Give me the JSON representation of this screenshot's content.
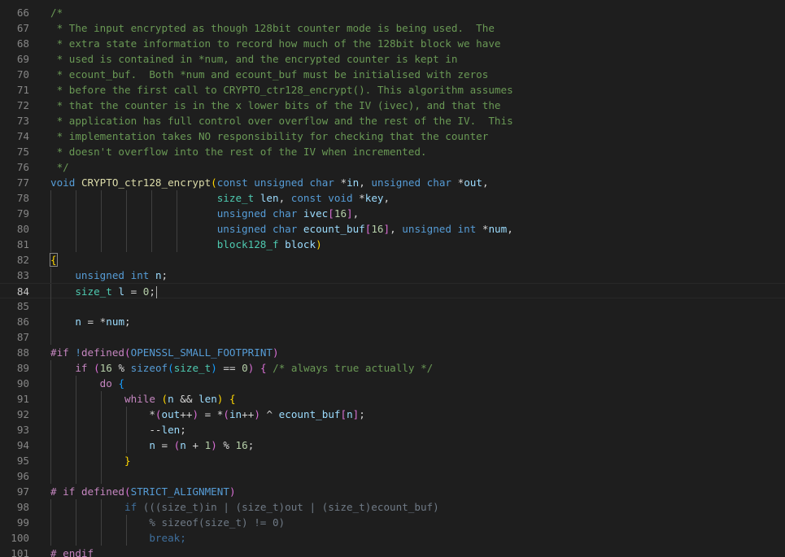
{
  "editor": {
    "current_line": 84,
    "colors": {
      "background": "#1e1e1e",
      "comment": "#6a9955",
      "keyword": "#569cd6",
      "control": "#c586c0",
      "function": "#dcdcaa",
      "type": "#4ec9b0",
      "variable": "#9cdcfe",
      "number": "#b5cea8",
      "plain": "#d4d4d4",
      "bracket_gold": "#ffd700",
      "bracket_purple": "#da70d6",
      "bracket_blue": "#179fff",
      "inactive": "#6f7a86"
    },
    "lines": [
      {
        "n": 66,
        "indent": 0,
        "t": [
          [
            "c",
            "/*"
          ]
        ]
      },
      {
        "n": 67,
        "indent": 0,
        "t": [
          [
            "c",
            " * The input encrypted as though 128bit counter mode is being used.  The"
          ]
        ]
      },
      {
        "n": 68,
        "indent": 0,
        "t": [
          [
            "c",
            " * extra state information to record how much of the 128bit block we have"
          ]
        ]
      },
      {
        "n": 69,
        "indent": 0,
        "t": [
          [
            "c",
            " * used is contained in *num, and the encrypted counter is kept in"
          ]
        ]
      },
      {
        "n": 70,
        "indent": 0,
        "t": [
          [
            "c",
            " * ecount_buf.  Both *num and ecount_buf must be initialised with zeros"
          ]
        ]
      },
      {
        "n": 71,
        "indent": 0,
        "t": [
          [
            "c",
            " * before the first call to CRYPTO_ctr128_encrypt(). This algorithm assumes"
          ]
        ]
      },
      {
        "n": 72,
        "indent": 0,
        "t": [
          [
            "c",
            " * that the counter is in the x lower bits of the IV (ivec), and that the"
          ]
        ]
      },
      {
        "n": 73,
        "indent": 0,
        "t": [
          [
            "c",
            " * application has full control over overflow and the rest of the IV.  This"
          ]
        ]
      },
      {
        "n": 74,
        "indent": 0,
        "t": [
          [
            "c",
            " * implementation takes NO responsibility for checking that the counter"
          ]
        ]
      },
      {
        "n": 75,
        "indent": 0,
        "t": [
          [
            "c",
            " * doesn't overflow into the rest of the IV when incremented."
          ]
        ]
      },
      {
        "n": 76,
        "indent": 0,
        "t": [
          [
            "c",
            " */"
          ]
        ]
      },
      {
        "n": 77,
        "indent": 0,
        "t": [
          [
            "k",
            "void"
          ],
          [
            "p",
            " "
          ],
          [
            "f",
            "CRYPTO_ctr128_encrypt"
          ],
          [
            "bg",
            "("
          ],
          [
            "k",
            "const"
          ],
          [
            "p",
            " "
          ],
          [
            "k",
            "unsigned"
          ],
          [
            "p",
            " "
          ],
          [
            "k",
            "char"
          ],
          [
            "p",
            " *"
          ],
          [
            "v",
            "in"
          ],
          [
            "p",
            ", "
          ],
          [
            "k",
            "unsigned"
          ],
          [
            "p",
            " "
          ],
          [
            "k",
            "char"
          ],
          [
            "p",
            " *"
          ],
          [
            "v",
            "out"
          ],
          [
            "p",
            ","
          ]
        ]
      },
      {
        "n": 78,
        "indent": 6,
        "pad": "                           ",
        "t": [
          [
            "ty",
            "size_t"
          ],
          [
            "p",
            " "
          ],
          [
            "v",
            "len"
          ],
          [
            "p",
            ", "
          ],
          [
            "k",
            "const"
          ],
          [
            "p",
            " "
          ],
          [
            "k",
            "void"
          ],
          [
            "p",
            " *"
          ],
          [
            "v",
            "key"
          ],
          [
            "p",
            ","
          ]
        ]
      },
      {
        "n": 79,
        "indent": 6,
        "pad": "                           ",
        "t": [
          [
            "k",
            "unsigned"
          ],
          [
            "p",
            " "
          ],
          [
            "k",
            "char"
          ],
          [
            "p",
            " "
          ],
          [
            "v",
            "ivec"
          ],
          [
            "bp",
            "["
          ],
          [
            "num",
            "16"
          ],
          [
            "bp",
            "]"
          ],
          [
            "p",
            ","
          ]
        ]
      },
      {
        "n": 80,
        "indent": 6,
        "pad": "                           ",
        "t": [
          [
            "k",
            "unsigned"
          ],
          [
            "p",
            " "
          ],
          [
            "k",
            "char"
          ],
          [
            "p",
            " "
          ],
          [
            "v",
            "ecount_buf"
          ],
          [
            "bp",
            "["
          ],
          [
            "num",
            "16"
          ],
          [
            "bp",
            "]"
          ],
          [
            "p",
            ", "
          ],
          [
            "k",
            "unsigned"
          ],
          [
            "p",
            " "
          ],
          [
            "k",
            "int"
          ],
          [
            "p",
            " *"
          ],
          [
            "v",
            "num"
          ],
          [
            "p",
            ","
          ]
        ]
      },
      {
        "n": 81,
        "indent": 6,
        "pad": "                           ",
        "t": [
          [
            "ty",
            "block128_f"
          ],
          [
            "p",
            " "
          ],
          [
            "v",
            "block"
          ],
          [
            "bg",
            ")"
          ]
        ]
      },
      {
        "n": 82,
        "indent": 0,
        "t": [
          [
            "bgx",
            "{"
          ]
        ]
      },
      {
        "n": 83,
        "indent": 1,
        "pad": "    ",
        "t": [
          [
            "k",
            "unsigned"
          ],
          [
            "p",
            " "
          ],
          [
            "k",
            "int"
          ],
          [
            "p",
            " "
          ],
          [
            "v",
            "n"
          ],
          [
            "p",
            ";"
          ]
        ]
      },
      {
        "n": 84,
        "indent": 1,
        "pad": "    ",
        "cursor": true,
        "t": [
          [
            "ty",
            "size_t"
          ],
          [
            "p",
            " "
          ],
          [
            "v",
            "l"
          ],
          [
            "p",
            " = "
          ],
          [
            "num",
            "0"
          ],
          [
            "p",
            ";"
          ]
        ]
      },
      {
        "n": 85,
        "indent": 1,
        "t": []
      },
      {
        "n": 86,
        "indent": 1,
        "pad": "    ",
        "t": [
          [
            "v",
            "n"
          ],
          [
            "p",
            " = *"
          ],
          [
            "v",
            "num"
          ],
          [
            "p",
            ";"
          ]
        ]
      },
      {
        "n": 87,
        "indent": 1,
        "t": []
      },
      {
        "n": 88,
        "indent": 0,
        "t": [
          [
            "ctl",
            "#if"
          ],
          [
            "p",
            " "
          ],
          [
            "k",
            "!"
          ],
          [
            "ctl",
            "defined"
          ],
          [
            "bp",
            "("
          ],
          [
            "k",
            "OPENSSL_SMALL_FOOTPRINT"
          ],
          [
            "bp",
            ")"
          ]
        ]
      },
      {
        "n": 89,
        "indent": 1,
        "pad": "    ",
        "t": [
          [
            "ctl",
            "if"
          ],
          [
            "p",
            " "
          ],
          [
            "bp",
            "("
          ],
          [
            "num",
            "16"
          ],
          [
            "p",
            " % "
          ],
          [
            "k",
            "sizeof"
          ],
          [
            "bb",
            "("
          ],
          [
            "ty",
            "size_t"
          ],
          [
            "bb",
            ")"
          ],
          [
            "p",
            " == "
          ],
          [
            "num",
            "0"
          ],
          [
            "bp",
            ")"
          ],
          [
            "p",
            " "
          ],
          [
            "bp",
            "{"
          ],
          [
            "p",
            " "
          ],
          [
            "c",
            "/* always true actually */"
          ]
        ]
      },
      {
        "n": 90,
        "indent": 2,
        "pad": "        ",
        "t": [
          [
            "ctl",
            "do"
          ],
          [
            "p",
            " "
          ],
          [
            "bb",
            "{"
          ]
        ]
      },
      {
        "n": 91,
        "indent": 3,
        "pad": "            ",
        "t": [
          [
            "ctl",
            "while"
          ],
          [
            "p",
            " "
          ],
          [
            "bg",
            "("
          ],
          [
            "v",
            "n"
          ],
          [
            "p",
            " && "
          ],
          [
            "v",
            "len"
          ],
          [
            "bg",
            ")"
          ],
          [
            "p",
            " "
          ],
          [
            "bg",
            "{"
          ]
        ]
      },
      {
        "n": 92,
        "indent": 4,
        "pad": "                ",
        "t": [
          [
            "p",
            "*"
          ],
          [
            "bp",
            "("
          ],
          [
            "v",
            "out"
          ],
          [
            "p",
            "++"
          ],
          [
            "bp",
            ")"
          ],
          [
            "p",
            " = *"
          ],
          [
            "bp",
            "("
          ],
          [
            "v",
            "in"
          ],
          [
            "p",
            "++"
          ],
          [
            "bp",
            ")"
          ],
          [
            "p",
            " ^ "
          ],
          [
            "v",
            "ecount_buf"
          ],
          [
            "bp",
            "["
          ],
          [
            "v",
            "n"
          ],
          [
            "bp",
            "]"
          ],
          [
            "p",
            ";"
          ]
        ]
      },
      {
        "n": 93,
        "indent": 4,
        "pad": "                ",
        "t": [
          [
            "p",
            "--"
          ],
          [
            "v",
            "len"
          ],
          [
            "p",
            ";"
          ]
        ]
      },
      {
        "n": 94,
        "indent": 4,
        "pad": "                ",
        "t": [
          [
            "v",
            "n"
          ],
          [
            "p",
            " = "
          ],
          [
            "bp",
            "("
          ],
          [
            "v",
            "n"
          ],
          [
            "p",
            " + "
          ],
          [
            "num",
            "1"
          ],
          [
            "bp",
            ")"
          ],
          [
            "p",
            " % "
          ],
          [
            "num",
            "16"
          ],
          [
            "p",
            ";"
          ]
        ]
      },
      {
        "n": 95,
        "indent": 3,
        "pad": "            ",
        "t": [
          [
            "bg",
            "}"
          ]
        ]
      },
      {
        "n": 96,
        "indent": 3,
        "t": []
      },
      {
        "n": 97,
        "indent": 0,
        "t": [
          [
            "ctl",
            "# if"
          ],
          [
            "p",
            " "
          ],
          [
            "ctl",
            "defined"
          ],
          [
            "bp",
            "("
          ],
          [
            "k",
            "STRICT_ALIGNMENT"
          ],
          [
            "bp",
            ")"
          ]
        ]
      },
      {
        "n": 98,
        "indent": 3,
        "pad": "            ",
        "t": [
          [
            "xc",
            "if"
          ],
          [
            "xp",
            " (((size_t)in | (size_t)out | (size_t)ecount_buf)"
          ]
        ]
      },
      {
        "n": 99,
        "indent": 4,
        "pad": "                ",
        "t": [
          [
            "xp",
            "% sizeof(size_t) != 0)"
          ]
        ]
      },
      {
        "n": 100,
        "indent": 4,
        "pad": "                ",
        "t": [
          [
            "xc",
            "break;"
          ]
        ]
      },
      {
        "n": 101,
        "indent": 0,
        "t": [
          [
            "ctl",
            "# endif"
          ]
        ]
      }
    ]
  }
}
